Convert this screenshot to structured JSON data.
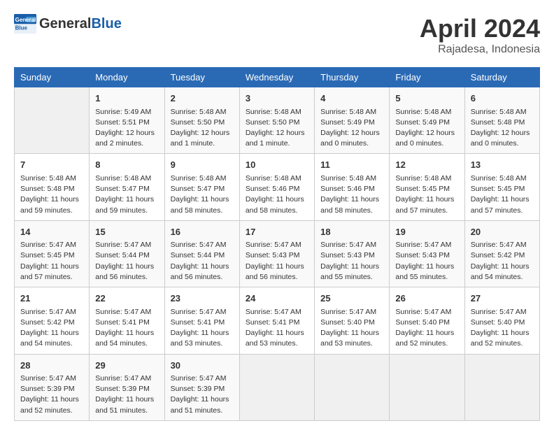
{
  "logo": {
    "general": "General",
    "blue": "Blue"
  },
  "header": {
    "month": "April 2024",
    "location": "Rajadesa, Indonesia"
  },
  "days_of_week": [
    "Sunday",
    "Monday",
    "Tuesday",
    "Wednesday",
    "Thursday",
    "Friday",
    "Saturday"
  ],
  "weeks": [
    [
      {
        "day": "",
        "info": ""
      },
      {
        "day": "1",
        "info": "Sunrise: 5:49 AM\nSunset: 5:51 PM\nDaylight: 12 hours\nand 2 minutes."
      },
      {
        "day": "2",
        "info": "Sunrise: 5:48 AM\nSunset: 5:50 PM\nDaylight: 12 hours\nand 1 minute."
      },
      {
        "day": "3",
        "info": "Sunrise: 5:48 AM\nSunset: 5:50 PM\nDaylight: 12 hours\nand 1 minute."
      },
      {
        "day": "4",
        "info": "Sunrise: 5:48 AM\nSunset: 5:49 PM\nDaylight: 12 hours\nand 0 minutes."
      },
      {
        "day": "5",
        "info": "Sunrise: 5:48 AM\nSunset: 5:49 PM\nDaylight: 12 hours\nand 0 minutes."
      },
      {
        "day": "6",
        "info": "Sunrise: 5:48 AM\nSunset: 5:48 PM\nDaylight: 12 hours\nand 0 minutes."
      }
    ],
    [
      {
        "day": "7",
        "info": "Sunrise: 5:48 AM\nSunset: 5:48 PM\nDaylight: 11 hours\nand 59 minutes."
      },
      {
        "day": "8",
        "info": "Sunrise: 5:48 AM\nSunset: 5:47 PM\nDaylight: 11 hours\nand 59 minutes."
      },
      {
        "day": "9",
        "info": "Sunrise: 5:48 AM\nSunset: 5:47 PM\nDaylight: 11 hours\nand 58 minutes."
      },
      {
        "day": "10",
        "info": "Sunrise: 5:48 AM\nSunset: 5:46 PM\nDaylight: 11 hours\nand 58 minutes."
      },
      {
        "day": "11",
        "info": "Sunrise: 5:48 AM\nSunset: 5:46 PM\nDaylight: 11 hours\nand 58 minutes."
      },
      {
        "day": "12",
        "info": "Sunrise: 5:48 AM\nSunset: 5:45 PM\nDaylight: 11 hours\nand 57 minutes."
      },
      {
        "day": "13",
        "info": "Sunrise: 5:48 AM\nSunset: 5:45 PM\nDaylight: 11 hours\nand 57 minutes."
      }
    ],
    [
      {
        "day": "14",
        "info": "Sunrise: 5:47 AM\nSunset: 5:45 PM\nDaylight: 11 hours\nand 57 minutes."
      },
      {
        "day": "15",
        "info": "Sunrise: 5:47 AM\nSunset: 5:44 PM\nDaylight: 11 hours\nand 56 minutes."
      },
      {
        "day": "16",
        "info": "Sunrise: 5:47 AM\nSunset: 5:44 PM\nDaylight: 11 hours\nand 56 minutes."
      },
      {
        "day": "17",
        "info": "Sunrise: 5:47 AM\nSunset: 5:43 PM\nDaylight: 11 hours\nand 56 minutes."
      },
      {
        "day": "18",
        "info": "Sunrise: 5:47 AM\nSunset: 5:43 PM\nDaylight: 11 hours\nand 55 minutes."
      },
      {
        "day": "19",
        "info": "Sunrise: 5:47 AM\nSunset: 5:43 PM\nDaylight: 11 hours\nand 55 minutes."
      },
      {
        "day": "20",
        "info": "Sunrise: 5:47 AM\nSunset: 5:42 PM\nDaylight: 11 hours\nand 54 minutes."
      }
    ],
    [
      {
        "day": "21",
        "info": "Sunrise: 5:47 AM\nSunset: 5:42 PM\nDaylight: 11 hours\nand 54 minutes."
      },
      {
        "day": "22",
        "info": "Sunrise: 5:47 AM\nSunset: 5:41 PM\nDaylight: 11 hours\nand 54 minutes."
      },
      {
        "day": "23",
        "info": "Sunrise: 5:47 AM\nSunset: 5:41 PM\nDaylight: 11 hours\nand 53 minutes."
      },
      {
        "day": "24",
        "info": "Sunrise: 5:47 AM\nSunset: 5:41 PM\nDaylight: 11 hours\nand 53 minutes."
      },
      {
        "day": "25",
        "info": "Sunrise: 5:47 AM\nSunset: 5:40 PM\nDaylight: 11 hours\nand 53 minutes."
      },
      {
        "day": "26",
        "info": "Sunrise: 5:47 AM\nSunset: 5:40 PM\nDaylight: 11 hours\nand 52 minutes."
      },
      {
        "day": "27",
        "info": "Sunrise: 5:47 AM\nSunset: 5:40 PM\nDaylight: 11 hours\nand 52 minutes."
      }
    ],
    [
      {
        "day": "28",
        "info": "Sunrise: 5:47 AM\nSunset: 5:39 PM\nDaylight: 11 hours\nand 52 minutes."
      },
      {
        "day": "29",
        "info": "Sunrise: 5:47 AM\nSunset: 5:39 PM\nDaylight: 11 hours\nand 51 minutes."
      },
      {
        "day": "30",
        "info": "Sunrise: 5:47 AM\nSunset: 5:39 PM\nDaylight: 11 hours\nand 51 minutes."
      },
      {
        "day": "",
        "info": ""
      },
      {
        "day": "",
        "info": ""
      },
      {
        "day": "",
        "info": ""
      },
      {
        "day": "",
        "info": ""
      }
    ]
  ]
}
